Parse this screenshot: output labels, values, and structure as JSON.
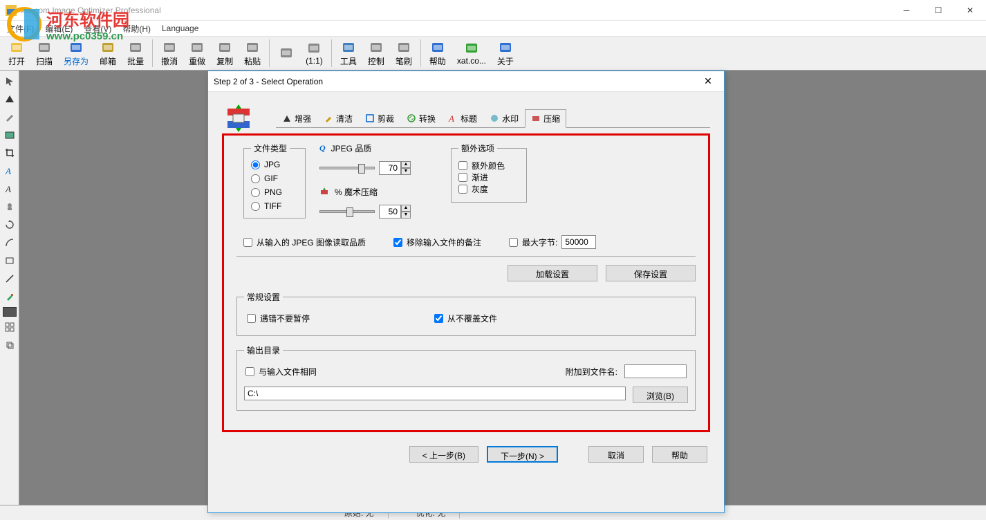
{
  "window": {
    "title": "xat.com  Image Optimizer Professional"
  },
  "watermark": {
    "line1": "河东软件园",
    "line2": "www.pc0359.cn"
  },
  "menubar": [
    "文件(F)",
    "编辑(E)",
    "查看(V)",
    "帮助(H)",
    "Language"
  ],
  "toolbar": [
    {
      "label": "打开",
      "icon": "open"
    },
    {
      "label": "扫描",
      "icon": "scan"
    },
    {
      "label": "另存为",
      "icon": "saveas",
      "blue": true
    },
    {
      "label": "邮箱",
      "icon": "mail"
    },
    {
      "label": "批量",
      "icon": "batch"
    },
    {
      "sep": true
    },
    {
      "label": "撤消",
      "icon": "undo"
    },
    {
      "label": "重做",
      "icon": "redo"
    },
    {
      "label": "复制",
      "icon": "copy"
    },
    {
      "label": "粘贴",
      "icon": "paste"
    },
    {
      "sep": true
    },
    {
      "label": "",
      "icon": "magic"
    },
    {
      "label": "(1:1)",
      "icon": "zoom"
    },
    {
      "sep": true
    },
    {
      "label": "工具",
      "icon": "tools"
    },
    {
      "label": "控制",
      "icon": "control"
    },
    {
      "label": "笔刷",
      "icon": "brush"
    },
    {
      "sep": true
    },
    {
      "label": "帮助",
      "icon": "help"
    },
    {
      "label": "xat.co...",
      "icon": "web"
    },
    {
      "label": "关于",
      "icon": "about"
    }
  ],
  "statusbar": {
    "left": "原始: 无",
    "right": "优化: 无"
  },
  "dialog": {
    "title": "Step 2 of 3 - Select Operation",
    "tabs": [
      "增强",
      "清洁",
      "剪裁",
      "转换",
      "标题",
      "水印",
      "压缩"
    ],
    "activeTab": 6,
    "compress": {
      "fileTypeLegend": "文件类型",
      "fileTypes": [
        "JPG",
        "GIF",
        "PNG",
        "TIFF"
      ],
      "selectedFileType": "JPG",
      "jpegQualityLabel": "JPEG 品质",
      "jpegQualityValue": "70",
      "magicLabel": "% 魔术压缩",
      "magicValue": "50",
      "extraLegend": "额外选项",
      "extraColor": "额外颜色",
      "progressive": "渐进",
      "grayscale": "灰度",
      "readFromInput": "从输入的 JPEG 图像读取品质",
      "removeComments": "移除输入文件的备注",
      "maxBytesLabel": "最大字节:",
      "maxBytesValue": "50000",
      "loadSettings": "加载设置",
      "saveSettings": "保存设置",
      "generalLegend": "常规设置",
      "noPauseOnError": "遇错不要暂停",
      "neverOverwrite": "从不覆盖文件",
      "outputLegend": "输出目录",
      "sameAsInput": "与输入文件相同",
      "appendLabel": "附加到文件名:",
      "appendValue": "",
      "path": "C:\\",
      "browse": "浏览(B)"
    },
    "nav": {
      "back": "< 上一步(B)",
      "next": "下一步(N) >",
      "cancel": "取消",
      "help": "帮助"
    }
  }
}
